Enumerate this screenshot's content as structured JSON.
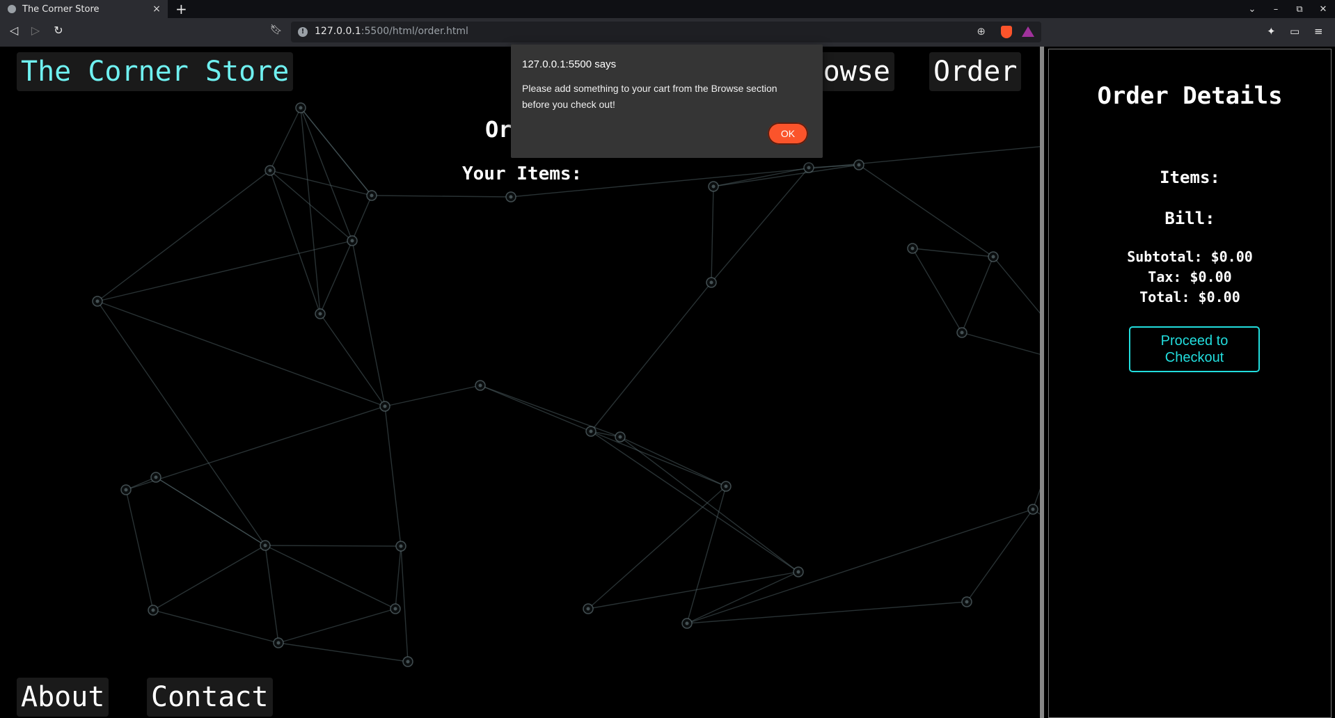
{
  "browser": {
    "tab_title": "The Corner Store",
    "tab_close": "×",
    "new_tab": "+",
    "url_host": "127.0.0.1",
    "url_rest": ":5500/html/order.html",
    "window_controls": {
      "collapse": "⌄",
      "minimize": "–",
      "restore": "⧉",
      "close": "✕"
    }
  },
  "nav": {
    "brand": "The Corner Store",
    "browse": "Browse",
    "order": "Order",
    "about": "About",
    "contact": "Contact"
  },
  "main": {
    "heading": "Or",
    "items_heading": "Your Items:"
  },
  "sidebar": {
    "title": "Order Details",
    "items_label": "Items:",
    "bill_label": "Bill:",
    "subtotal": "Subtotal: $0.00",
    "tax": "Tax: $0.00",
    "total": "Total: $0.00",
    "checkout_button": "Proceed to Checkout"
  },
  "dialog": {
    "origin": "127.0.0.1:5500 says",
    "message": "Please add something to your cart from the Browse section before you check out!",
    "ok_label": "OK"
  },
  "colors": {
    "brand": "#6ff0f0",
    "accent": "#22dddd",
    "dialog_button": "#fb542b"
  }
}
